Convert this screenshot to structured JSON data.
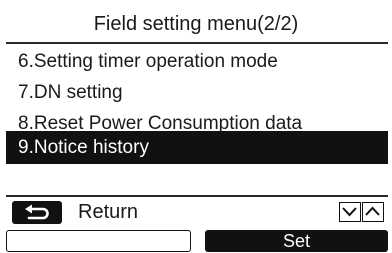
{
  "header": {
    "title": "Field setting menu(2/2)"
  },
  "menu": {
    "items": [
      {
        "label": "6.Setting timer operation mode",
        "selected": false
      },
      {
        "label": "7.DN setting",
        "selected": false
      },
      {
        "label": "8.Reset Power Consumption data",
        "selected": false
      },
      {
        "label": "9.Notice history",
        "selected": true
      }
    ]
  },
  "footer": {
    "return_label": "Return",
    "return_icon": "return-arrow-icon",
    "down_icon": "chevron-down-icon",
    "up_icon": "chevron-up-icon",
    "left_softkey_label": "",
    "set_label": "Set"
  },
  "colors": {
    "background": "#ffffff",
    "foreground": "#111111",
    "highlight_text": "#ffffff"
  }
}
